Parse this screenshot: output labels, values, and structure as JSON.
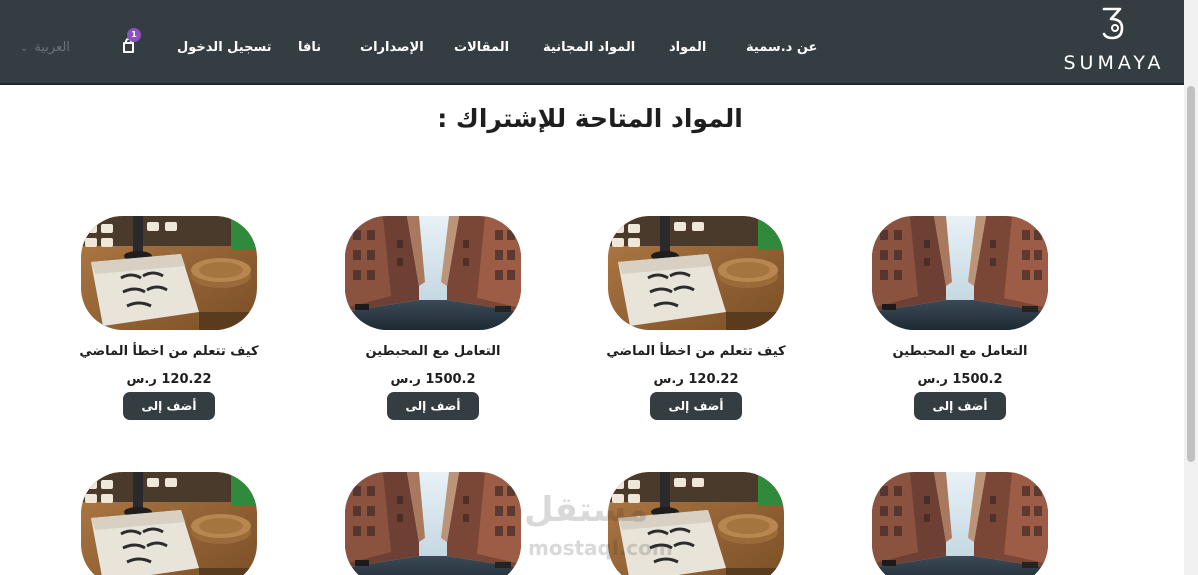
{
  "brand": {
    "name": "SUMAYA"
  },
  "nav": {
    "items": [
      {
        "key": "about",
        "label": "عن د.سمية"
      },
      {
        "key": "materials",
        "label": "المواد"
      },
      {
        "key": "free",
        "label": "المواد المجانية"
      },
      {
        "key": "articles",
        "label": "المقالات"
      },
      {
        "key": "releases",
        "label": "الإصدارات"
      },
      {
        "key": "nafa",
        "label": "نافا"
      },
      {
        "key": "login",
        "label": "تسجيل الدخول"
      }
    ],
    "cart_count": "1",
    "language": "العربية"
  },
  "page": {
    "heading": "المواد المتاحة للإشتراك :"
  },
  "products": [
    {
      "title": "التعامل مع المحبطين",
      "price": "1500.2 ر.س",
      "button": "أضف إلى السلة",
      "image": "street"
    },
    {
      "title": "كيف تتعلم من اخطأ الماضي",
      "price": "120.22 ر.س",
      "button": "أضف إلى السلة",
      "image": "desk"
    },
    {
      "title": "التعامل مع المحبطين",
      "price": "1500.2 ر.س",
      "button": "أضف إلى السلة",
      "image": "street"
    },
    {
      "title": "كيف تتعلم من اخطأ الماضي",
      "price": "120.22 ر.س",
      "button": "أضف إلى السلة",
      "image": "desk"
    }
  ],
  "products_row2": [
    {
      "image": "street"
    },
    {
      "image": "desk"
    },
    {
      "image": "street"
    },
    {
      "image": "desk"
    }
  ],
  "watermark": {
    "arabic": "مستقل",
    "latin": "mostaql.com"
  },
  "colors": {
    "navbar": "#343d42",
    "button": "#343d42",
    "badge": "#8e4fbf"
  }
}
